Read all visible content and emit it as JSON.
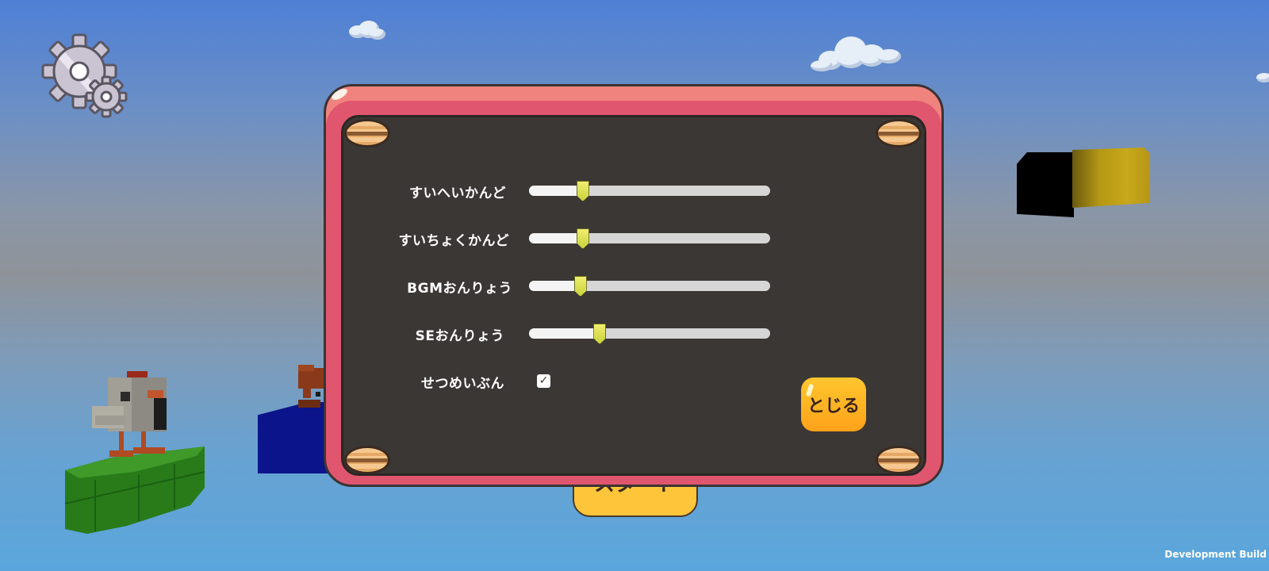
{
  "settings_panel": {
    "rows": [
      {
        "label": "すいへいかんど",
        "value": 0.22
      },
      {
        "label": "すいちょくかんど",
        "value": 0.22
      },
      {
        "label": "BGMおんりょう",
        "value": 0.21
      },
      {
        "label": "SEおんりょう",
        "value": 0.29
      }
    ],
    "explanation": {
      "label": "せつめいぶん",
      "checked": true,
      "check_glyph": "✓"
    },
    "close_label": "とじる"
  },
  "background_button": {
    "label": "スタート"
  },
  "build_label": "Development Build",
  "icons": {
    "settings": "gear-icon"
  },
  "colors": {
    "panel_frame": "#e0566e",
    "panel_inner": "#3b3735",
    "close_button": "#ffb020",
    "slider_handle": "#d8dc4a"
  }
}
